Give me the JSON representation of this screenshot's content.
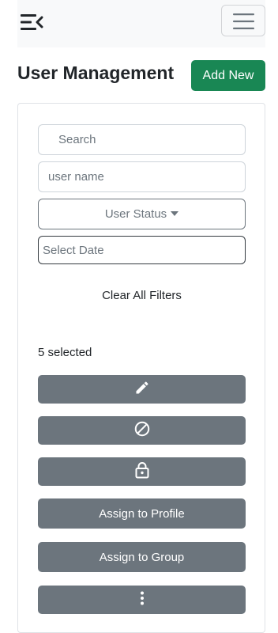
{
  "header": {
    "collapse_icon": "sidebar-collapse-icon",
    "menu_icon": "hamburger-menu-icon"
  },
  "page": {
    "title": "User Management",
    "add_new_label": "Add New"
  },
  "colors": {
    "primary_green": "#198754",
    "secondary_gray": "#6c757d"
  },
  "filters": {
    "search_placeholder": "Search",
    "username_placeholder": "user name",
    "status_label": "User Status",
    "date_placeholder": "Select Date",
    "clear_label": "Clear All Filters"
  },
  "selection": {
    "count_text": "5 selected"
  },
  "actions": {
    "edit_icon": "pencil-icon",
    "disable_icon": "block-icon",
    "lock_icon": "lock-icon",
    "assign_profile_label": "Assign to Profile",
    "assign_group_label": "Assign to Group",
    "more_icon": "more-vertical-icon"
  }
}
